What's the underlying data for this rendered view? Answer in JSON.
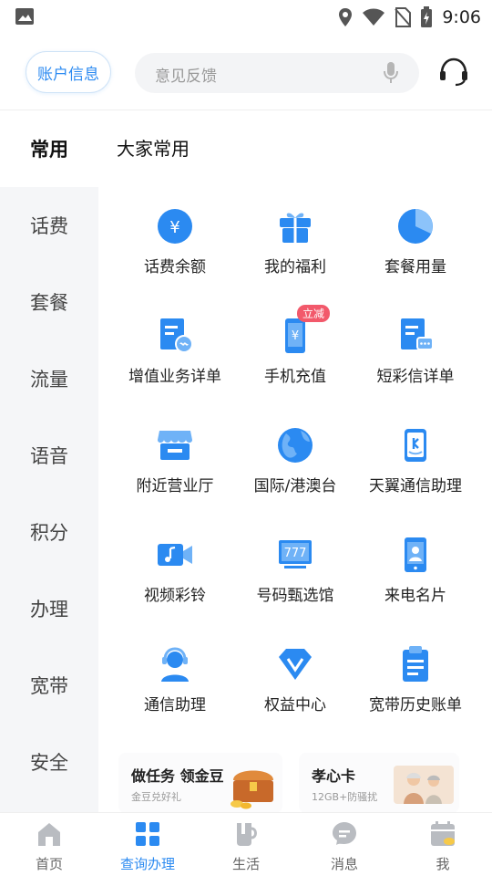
{
  "status_bar": {
    "time": "9:06"
  },
  "header": {
    "account_button": "账户信息",
    "search_placeholder": "意见反馈"
  },
  "sidebar": {
    "items": [
      {
        "label": "常用",
        "active": true
      },
      {
        "label": "话费"
      },
      {
        "label": "套餐"
      },
      {
        "label": "流量"
      },
      {
        "label": "语音"
      },
      {
        "label": "积分"
      },
      {
        "label": "办理"
      },
      {
        "label": "宽带"
      },
      {
        "label": "安全"
      }
    ]
  },
  "main": {
    "section_title": "大家常用",
    "grid": [
      {
        "label": "话费余额",
        "icon": "yuan-coin-icon"
      },
      {
        "label": "我的福利",
        "icon": "gift-icon"
      },
      {
        "label": "套餐用量",
        "icon": "pie-chart-icon"
      },
      {
        "label": "增值业务详单",
        "icon": "document-chat-icon"
      },
      {
        "label": "手机充值",
        "icon": "phone-recharge-icon",
        "badge": "立减"
      },
      {
        "label": "短彩信详单",
        "icon": "document-message-icon"
      },
      {
        "label": "附近营业厅",
        "icon": "store-icon"
      },
      {
        "label": "国际/港澳台",
        "icon": "globe-icon"
      },
      {
        "label": "天翼通信助理",
        "icon": "phone-assistant-icon"
      },
      {
        "label": "视频彩铃",
        "icon": "video-ringtone-icon"
      },
      {
        "label": "号码甄选馆",
        "icon": "number-display-icon"
      },
      {
        "label": "来电名片",
        "icon": "caller-card-icon"
      },
      {
        "label": "通信助理",
        "icon": "headset-person-icon"
      },
      {
        "label": "权益中心",
        "icon": "diamond-icon"
      },
      {
        "label": "宽带历史账单",
        "icon": "clipboard-icon"
      }
    ],
    "promos": [
      {
        "title": "做任务 领金豆",
        "subtitle": "金豆兑好礼"
      },
      {
        "title": "孝心卡",
        "subtitle": "12GB+防骚扰"
      }
    ]
  },
  "tabbar": {
    "items": [
      {
        "label": "首页"
      },
      {
        "label": "查询办理",
        "active": true
      },
      {
        "label": "生活"
      },
      {
        "label": "消息"
      },
      {
        "label": "我"
      }
    ]
  },
  "colors": {
    "accent": "#2b8af1",
    "badge": "#f2596b",
    "sidebar_bg": "#f5f6f8"
  }
}
